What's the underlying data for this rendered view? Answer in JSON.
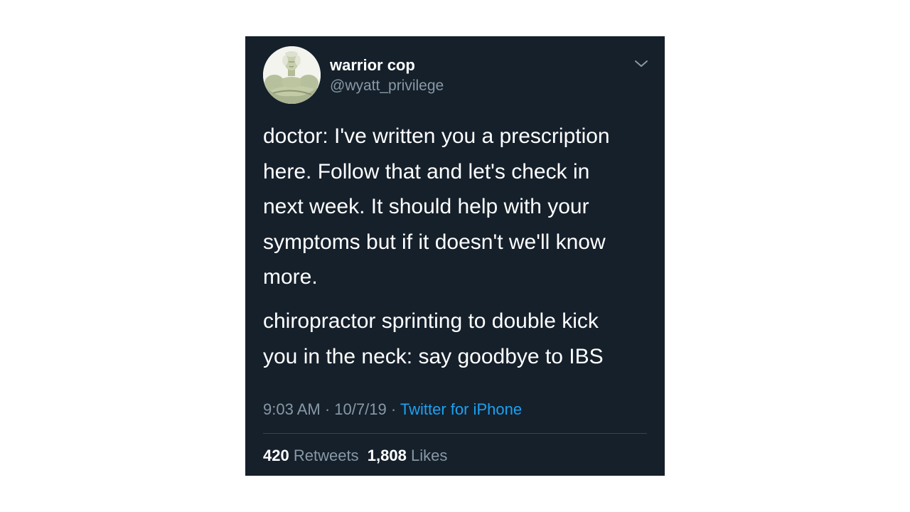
{
  "tweet": {
    "author": {
      "name": "warrior cop",
      "handle": "@wyatt_privilege",
      "avatar_icon": "muscular-statue-avatar"
    },
    "menu_icon": "chevron-down-icon",
    "text_paragraphs": [
      "doctor: I've written you a prescription\nhere. Follow that and let's check in\nnext week. It should help with your\nsymptoms but if it doesn't we'll know\nmore.",
      "chiropractor sprinting to double kick\nyou in the neck: say goodbye to IBS"
    ],
    "time": "9:03 AM",
    "separator": "·",
    "date": "10/7/19",
    "source": "Twitter for iPhone",
    "stats": {
      "retweets_count": "420",
      "retweets_label": "Retweets",
      "likes_count": "1,808",
      "likes_label": "Likes"
    }
  },
  "colors": {
    "background": "#15202b",
    "text": "#ffffff",
    "muted": "#8899a6",
    "link": "#1da1f2",
    "divider": "#38444d"
  }
}
